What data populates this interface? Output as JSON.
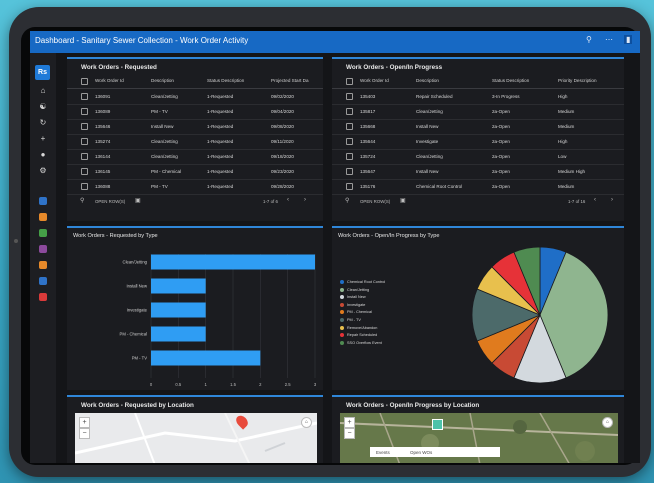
{
  "app": {
    "title": "Dashboard - Sanitary Sewer Collection - Work Order Activity",
    "logo": "Rs",
    "header_icons": [
      "search-icon",
      "more-icon",
      "bookmark-icon"
    ]
  },
  "sidebar": {
    "nav_icons": [
      "home-icon",
      "network-icon",
      "history-icon",
      "plus-icon",
      "compass-icon",
      "settings-icon"
    ],
    "app_colors": [
      "#2f73c8",
      "#e6892a",
      "#45a047",
      "#8c4a9c",
      "#e6892a",
      "#2f73c8",
      "#d93a3a"
    ]
  },
  "requested": {
    "title": "Work Orders - Requested",
    "columns": [
      "Work Order Id",
      "Description",
      "Status Description",
      "Projected Start Da"
    ],
    "rows": [
      [
        "136091",
        "Clean/Jetting",
        "1-Requested",
        "09/02/2020"
      ],
      [
        "136089",
        "PM - TV",
        "1-Requested",
        "09/04/2020"
      ],
      [
        "135646",
        "Install New",
        "1-Requested",
        "09/08/2020"
      ],
      [
        "135274",
        "Clean/Jetting",
        "1-Requested",
        "09/11/2020"
      ],
      [
        "136144",
        "Clean/Jetting",
        "1-Requested",
        "09/18/2020"
      ],
      [
        "136145",
        "PM - Chemical",
        "1-Requested",
        "09/23/2020"
      ],
      [
        "136088",
        "PM - TV",
        "1-Requested",
        "09/28/2020"
      ]
    ],
    "open_rows_label": "OPEN ROW(S)",
    "pagination": "1-7 of 6"
  },
  "inprogress": {
    "title": "Work Orders - Open/In Progress",
    "columns": [
      "Work Order Id",
      "Description",
      "Status Description",
      "Priority Description"
    ],
    "rows": [
      [
        "135403",
        "Repair Scheduled",
        "3-In Progress",
        "High"
      ],
      [
        "135817",
        "Clean/Jetting",
        "2a-Open",
        "Medium"
      ],
      [
        "135668",
        "Install New",
        "2a-Open",
        "Medium"
      ],
      [
        "135644",
        "Investigate",
        "2a-Open",
        "High"
      ],
      [
        "135724",
        "Clean/Jetting",
        "2a-Open",
        "Low"
      ],
      [
        "135647",
        "Install New",
        "2a-Open",
        "Medium High"
      ],
      [
        "135176",
        "Chemical Root Control",
        "2a-Open",
        "Medium"
      ]
    ],
    "open_rows_label": "OPEN ROW(S)",
    "pagination": "1-7 of 16"
  },
  "bar_panel_title": "Work Orders - Requested by Type",
  "pie_panel_title": "Work Orders - Open/In Progress by Type",
  "chart_data": [
    {
      "type": "bar",
      "orientation": "horizontal",
      "title": "Work Orders - Requested by Type",
      "categories": [
        "Clean/Jetting",
        "Install New",
        "Investigate",
        "PM - Chemical",
        "PM - TV"
      ],
      "values": [
        3,
        1,
        1,
        1,
        2
      ],
      "xlim": [
        0,
        3
      ],
      "xticks": [
        "0",
        "0.5",
        "1",
        "1.5",
        "2",
        "2.5",
        "3"
      ],
      "color": "#2f9df3",
      "grid": true
    },
    {
      "type": "pie",
      "title": "Work Orders - Open/In Progress by Type",
      "labels": [
        "Chemical Root Control",
        "Clean/Jetting",
        "Install New",
        "Investigate",
        "PM - Chemical",
        "PM - TV",
        "Remove/Abandon",
        "Repair Scheduled",
        "SSO Overflow Event"
      ],
      "values": [
        1,
        6,
        2,
        1,
        1,
        2,
        1,
        1,
        1
      ],
      "colors": [
        "#1f6ec7",
        "#8fb58f",
        "#d3d9de",
        "#c84a34",
        "#e07b1e",
        "#4c6a6a",
        "#e8c04d",
        "#e63238",
        "#4f8b51"
      ],
      "legend": "left"
    }
  ],
  "map_requested": {
    "title": "Work Orders - Requested by Location"
  },
  "map_inprogress": {
    "title": "Work Orders - Open/In Progress by Location",
    "tab_labels": [
      "Events",
      "Open WOs"
    ]
  }
}
